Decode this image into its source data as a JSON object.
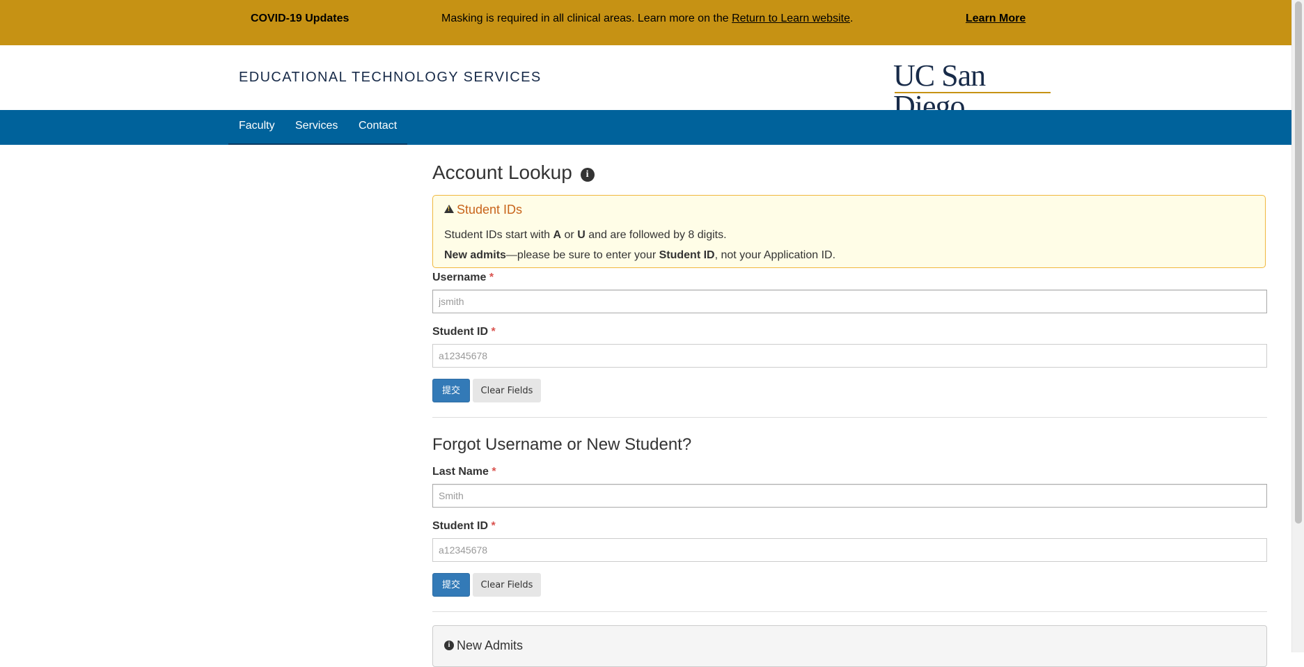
{
  "banner": {
    "title": "COVID-19 Updates",
    "message_prefix": "Masking is required in all clinical areas. Learn more on the ",
    "message_link": "Return to Learn website",
    "message_suffix": ".",
    "learn_more": "Learn More",
    "bg_color": "#C69214"
  },
  "header": {
    "site_title": "EDUCATIONAL TECHNOLOGY SERVICES",
    "logo_text": "UC San Diego",
    "brand_navy": "#182B49"
  },
  "nav": {
    "bg_color": "#00629B",
    "items": [
      {
        "label": "Faculty"
      },
      {
        "label": "Services"
      },
      {
        "label": "Contact"
      }
    ]
  },
  "main": {
    "title": "Account Lookup",
    "title_icon": "info-circle-icon",
    "alert": {
      "icon": "warning-icon",
      "heading": "Student IDs",
      "line1": {
        "t1": "Student IDs start with ",
        "b1": "A",
        "t2": " or ",
        "b2": "U",
        "t3": " and are followed by 8 digits."
      },
      "line2": {
        "b1": "New admits",
        "t1": "—please be sure to enter your ",
        "b2": "Student ID",
        "t2": ", not your Application ID."
      }
    },
    "form1": {
      "username_label": "Username",
      "username_placeholder": "jsmith",
      "studentid_label": "Student ID",
      "studentid_placeholder": "a12345678",
      "submit_label": "提交",
      "clear_label": "Clear Fields"
    },
    "section2_title": "Forgot Username or New Student?",
    "form2": {
      "lastname_label": "Last Name",
      "lastname_placeholder": "Smith",
      "studentid_label": "Student ID",
      "studentid_placeholder": "a12345678",
      "submit_label": "提交",
      "clear_label": "Clear Fields"
    },
    "required_marker": "*",
    "new_admits_heading": "New Admits",
    "new_admits_icon": "info-circle-icon"
  }
}
